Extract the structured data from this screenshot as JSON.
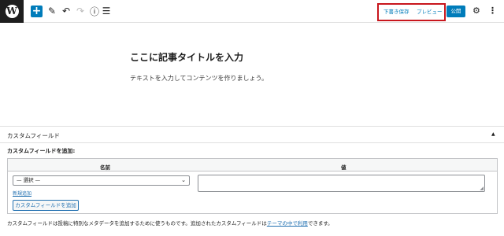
{
  "toolbar": {
    "logo": "W",
    "add_icon": "+",
    "pen_icon": "✎",
    "undo_icon": "↶",
    "redo_icon": "↷",
    "info_icon": "ⓘ",
    "list_icon": "☰",
    "save_draft": "下書き保存",
    "preview": "プレビュー",
    "publish": "公開",
    "gear_icon": "⚙",
    "more_icon": "⋮",
    "accent_color": "#007cba",
    "highlight_color": "#c8161d"
  },
  "editor": {
    "title_placeholder": "ここに記事タイトルを入力",
    "body_placeholder": "テキストを入力してコンテンツを作りましょう。"
  },
  "custom_fields": {
    "panel_title": "カスタムフィールド",
    "toggle_icon": "▲",
    "add_label": "カスタムフィールドを追加:",
    "col_name": "名前",
    "col_value": "値",
    "select_value": "— 選択 —",
    "chevron_icon": "⌄",
    "new_link": "新規追加",
    "add_button": "カスタムフィールドを追加",
    "description_before": "カスタムフィールドは投稿に特別なメタデータを追加するために使うものです。追加されたカスタムフィールドは",
    "description_link": "テーマの中で利用",
    "description_after": "できます。"
  }
}
